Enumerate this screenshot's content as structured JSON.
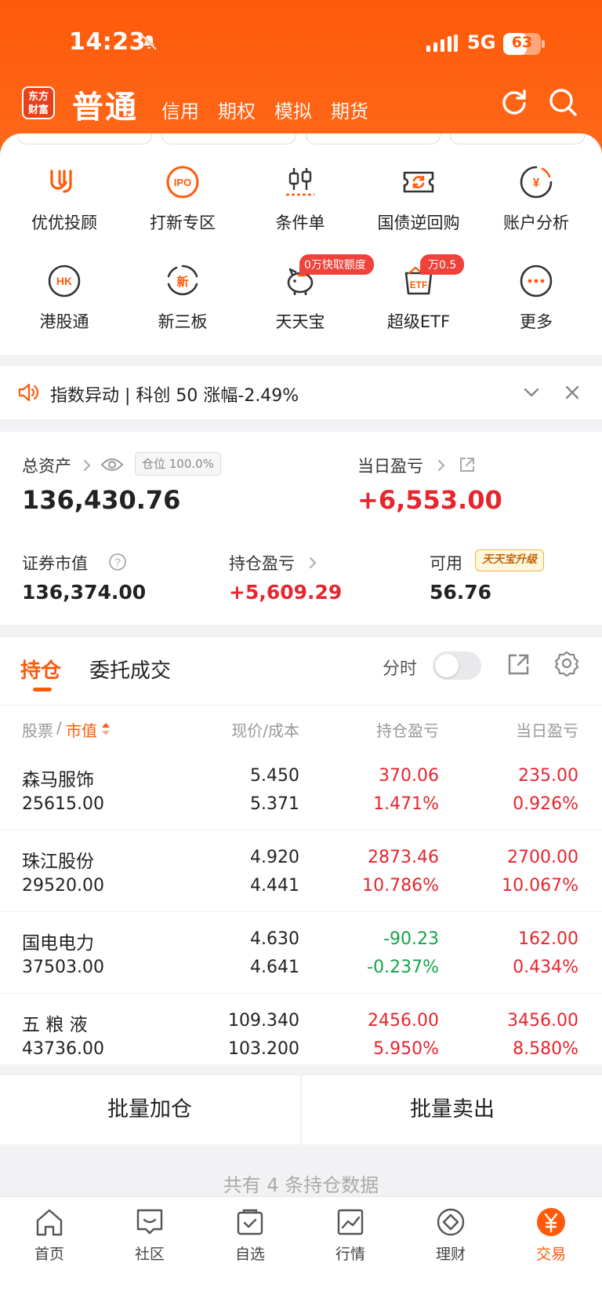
{
  "status": {
    "time": "14:23",
    "network": "5G",
    "battery": "63",
    "battery_level": 0.63
  },
  "header": {
    "logo_line1": "东方",
    "logo_line2": "财富",
    "active_account": "普通",
    "account_tabs": [
      "信用",
      "期权",
      "模拟",
      "期货"
    ]
  },
  "quick_actions": [
    {
      "label": "优优投顾",
      "icon": "youyou-advisor-icon"
    },
    {
      "label": "打新专区",
      "icon": "ipo-icon",
      "icon_text": "IPO"
    },
    {
      "label": "条件单",
      "icon": "candlestick-icon"
    },
    {
      "label": "国债逆回购",
      "icon": "bond-repo-icon"
    },
    {
      "label": "账户分析",
      "icon": "account-analysis-icon",
      "icon_text": "¥"
    },
    {
      "label": "港股通",
      "icon": "hk-connect-icon",
      "icon_text": "HK"
    },
    {
      "label": "新三板",
      "icon": "new-third-board-icon",
      "icon_text": "新"
    },
    {
      "label": "天天宝",
      "icon": "piggy-bank-icon",
      "badge": "0万快取额度"
    },
    {
      "label": "超级ETF",
      "icon": "etf-icon",
      "icon_text": "ETF",
      "badge": "万0.5"
    },
    {
      "label": "更多",
      "icon": "more-icon"
    }
  ],
  "notice": {
    "text": "指数异动 | 科创 50 涨幅-2.49%"
  },
  "assets": {
    "total_label": "总资产",
    "position_ratio": "仓位 100.0%",
    "total_value": "136,430.76",
    "daily_pnl_label": "当日盈亏",
    "daily_pnl_value": "+6,553.00",
    "market_value_label": "证券市值",
    "market_value": "136,374.00",
    "holding_pnl_label": "持仓盈亏",
    "holding_pnl_value": "+5,609.29",
    "available_label": "可用",
    "available_value": "56.76",
    "upgrade_badge": "天天宝升级"
  },
  "holdings": {
    "tabs": [
      "持仓",
      "委托成交"
    ],
    "toggle_label": "分时",
    "columns": {
      "stock": "股票",
      "sep": "/",
      "market_value": "市值",
      "price_cost": "现价/成本",
      "holding_pnl": "持仓盈亏",
      "daily_pnl": "当日盈亏"
    },
    "rows": [
      {
        "name": "森马服饰",
        "market_value": "25615.00",
        "price": "5.450",
        "cost": "5.371",
        "holding_pnl": "370.06",
        "holding_pct": "1.471%",
        "daily_pnl": "235.00",
        "daily_pct": "0.926%",
        "holding_dir": "up",
        "daily_dir": "up"
      },
      {
        "name": "珠江股份",
        "market_value": "29520.00",
        "price": "4.920",
        "cost": "4.441",
        "holding_pnl": "2873.46",
        "holding_pct": "10.786%",
        "daily_pnl": "2700.00",
        "daily_pct": "10.067%",
        "holding_dir": "up",
        "daily_dir": "up"
      },
      {
        "name": "国电电力",
        "market_value": "37503.00",
        "price": "4.630",
        "cost": "4.641",
        "holding_pnl": "-90.23",
        "holding_pct": "-0.237%",
        "daily_pnl": "162.00",
        "daily_pct": "0.434%",
        "holding_dir": "down",
        "daily_dir": "up"
      },
      {
        "name": "五 粮 液",
        "market_value": "43736.00",
        "price": "109.340",
        "cost": "103.200",
        "holding_pnl": "2456.00",
        "holding_pct": "5.950%",
        "daily_pnl": "3456.00",
        "daily_pct": "8.580%",
        "holding_dir": "up",
        "daily_dir": "up"
      }
    ]
  },
  "batch": {
    "add": "批量加仓",
    "sell": "批量卖出"
  },
  "summary": "共有 4 条持仓数据",
  "bottom_nav": [
    {
      "label": "首页",
      "icon": "home-icon"
    },
    {
      "label": "社区",
      "icon": "community-icon"
    },
    {
      "label": "自选",
      "icon": "watchlist-icon"
    },
    {
      "label": "行情",
      "icon": "market-icon"
    },
    {
      "label": "理财",
      "icon": "wealth-icon"
    },
    {
      "label": "交易",
      "icon": "trade-icon",
      "active": true
    }
  ],
  "colors": {
    "brand": "#ff5a0a",
    "up": "#e5262e",
    "down": "#16a34a"
  }
}
